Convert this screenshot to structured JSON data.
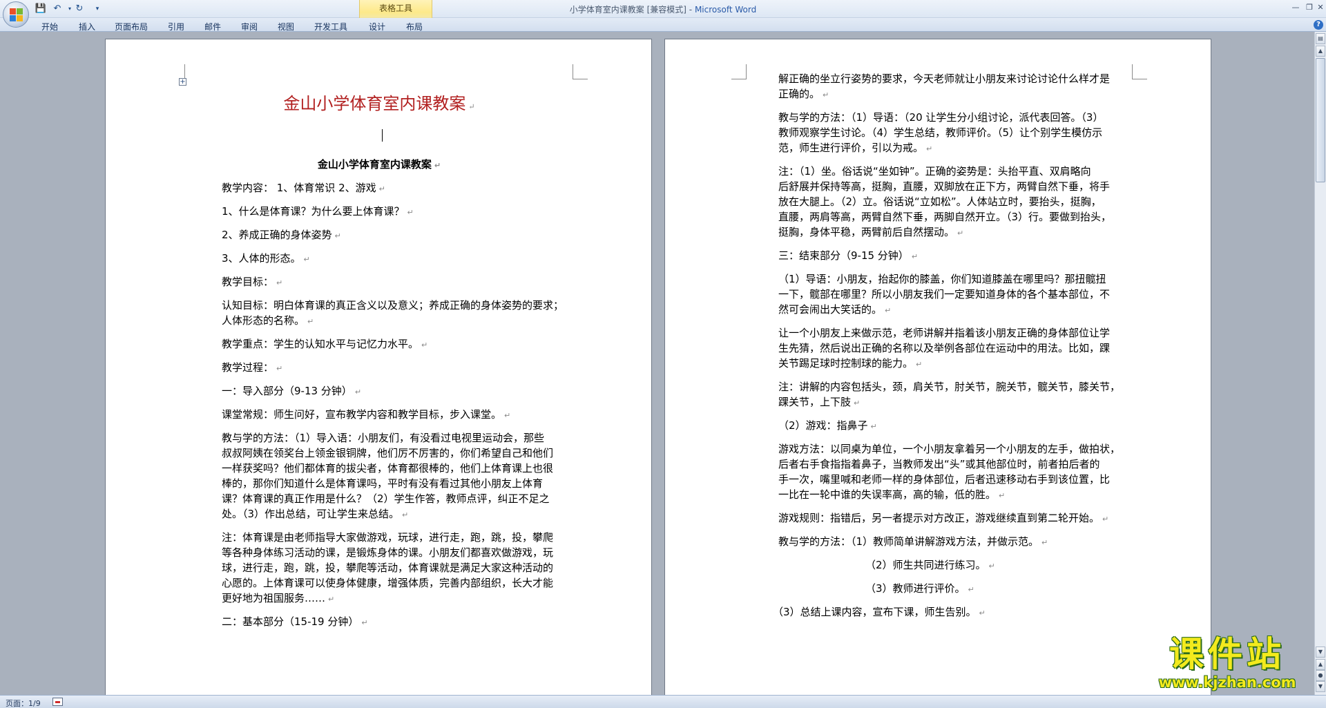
{
  "window": {
    "doc_name": "小学体育室内课教案 [兼容模式]",
    "separator": " - ",
    "app_name": "Microsoft Word",
    "context_tab_group": "表格工具"
  },
  "ribbon": {
    "tabs": [
      "开始",
      "插入",
      "页面布局",
      "引用",
      "邮件",
      "审阅",
      "视图",
      "开发工具",
      "设计",
      "布局"
    ]
  },
  "page1": {
    "title": "金山小学体育室内课教案",
    "subtitle": "金山小学体育室内课教案",
    "paragraphs": [
      {
        "lines": [
          "教学内容：  1、体育常识       2、游戏"
        ]
      },
      {
        "lines": [
          "1、什么是体育课？为什么要上体育课？"
        ]
      },
      {
        "lines": [
          "2、养成正确的身体姿势"
        ]
      },
      {
        "lines": [
          "3、人体的形态。"
        ]
      },
      {
        "lines": [
          "教学目标："
        ]
      },
      {
        "lines": [
          "认知目标：明白体育课的真正含义以及意义；养成正确的身体姿势的要求；",
          "人体形态的名称。"
        ]
      },
      {
        "lines": [
          "教学重点：学生的认知水平与记忆力水平。"
        ]
      },
      {
        "lines": [
          "教学过程："
        ]
      },
      {
        "lines": [
          "一：导入部分（9-13 分钟）"
        ]
      },
      {
        "lines": [
          "课堂常规：师生问好，宣布教学内容和教学目标，步入课堂。"
        ]
      },
      {
        "lines": [
          "教与学的方法：（1）导入语：小朋友们，有没看过电视里运动会，那些",
          "叔叔阿姨在领奖台上领金银铜牌，他们厉不厉害的，你们希望自己和他们",
          "一样获奖吗？他们都体育的拔尖者，体育都很棒的，他们上体育课上也很",
          "棒的，那你们知道什么是体育课吗，平时有没有看过其他小朋友上体育",
          "课？体育课的真正作用是什么？（2）学生作答，教师点评，纠正不足之",
          "处。（3）作出总结，可让学生来总结。"
        ]
      },
      {
        "lines": [
          "注：体育课是由老师指导大家做游戏，玩球，进行走，跑，跳，投，攀爬",
          "等各种身体练习活动的课，是锻炼身体的课。小朋友们都喜欢做游戏，玩",
          "球，进行走，跑，跳，投，攀爬等活动，体育课就是满足大家这种活动的",
          "心愿的。上体育课可以使身体健康，增强体质，完善内部组织，长大才能",
          "更好地为祖国服务……"
        ]
      },
      {
        "lines": [
          "二：基本部分（15-19 分钟）"
        ]
      }
    ]
  },
  "page2": {
    "paragraphs": [
      {
        "lines": [
          "解正确的坐立行姿势的要求，今天老师就让小朋友来讨论讨论什么样才是",
          "正确的。"
        ]
      },
      {
        "lines": [
          "教与学的方法：（1）导语：（20 让学生分小组讨论，派代表回答。（3）",
          "教师观察学生讨论。（4）学生总结，教师评价。（5）让个别学生模仿示",
          "范，师生进行评价，引以为戒。"
        ]
      },
      {
        "lines": [
          "注：（1）坐。俗话说“坐如钟”。正确的姿势是：头抬平直、双肩略向",
          "后舒展并保持等高，挺胸，直腰，双脚放在正下方，两臂自然下垂，将手",
          "放在大腿上。（2）立。俗话说“立如松”。人体站立时，要抬头，挺胸，",
          "直腰，两肩等高，两臂自然下垂，两脚自然开立。（3）行。要做到抬头，",
          "挺胸，身体平稳，两臂前后自然摆动。"
        ]
      },
      {
        "lines": [
          "三：结束部分（9-15 分钟）"
        ]
      },
      {
        "lines": [
          "（1）导语：小朋友，抬起你的膝盖，你们知道膝盖在哪里吗？那扭髋扭",
          "一下，髋部在哪里？所以小朋友我们一定要知道身体的各个基本部位，不",
          "然可会闹出大笑话的。"
        ]
      },
      {
        "lines": [
          "让一个小朋友上来做示范，老师讲解并指着该小朋友正确的身体部位让学",
          "生先猜，然后说出正确的名称以及举例各部位在运动中的用法。比如，踝",
          "关节踢足球时控制球的能力。"
        ]
      },
      {
        "lines": [
          "注：讲解的内容包括头，颈，肩关节，肘关节，腕关节，髋关节，膝关节，",
          "踝关节，上下肢"
        ]
      },
      {
        "lines": [
          "（2）游戏：指鼻子"
        ]
      },
      {
        "lines": [
          "游戏方法：以同桌为单位，一个小朋友拿着另一个小朋友的左手，做拍状，",
          "后者右手食指指着鼻子，当教师发出“头”或其他部位时，前者拍后者的",
          "手一次，嘴里喊和老师一样的身体部位，后者迅速移动右手到该位置，比",
          "一比在一轮中谁的失误率高，高的输，低的胜。"
        ]
      },
      {
        "lines": [
          "游戏规则：指错后，另一者提示对方改正，游戏继续直到第二轮开始。"
        ]
      },
      {
        "lines": [
          "教与学的方法：（1）教师简单讲解游戏方法，并做示范。"
        ]
      },
      {
        "lines": [
          "（2）师生共同进行练习。"
        ]
      },
      {
        "lines": [
          "（3）教师进行评价。"
        ]
      },
      {
        "lines": [
          "（3）总结上课内容，宣布下课，师生告别。"
        ]
      }
    ]
  },
  "statusbar": {
    "page_indicator": "页面：1/9"
  },
  "watermark": {
    "text": "课件站",
    "url": "www.kjzhan.com"
  },
  "marks": {
    "paragraph": "↵"
  },
  "colors": {
    "title_red": "#b22020",
    "ribbon_blue": "#15315c",
    "watermark_yellow": "#f3ea1d",
    "context_tab_yellow": "#fde98a"
  }
}
